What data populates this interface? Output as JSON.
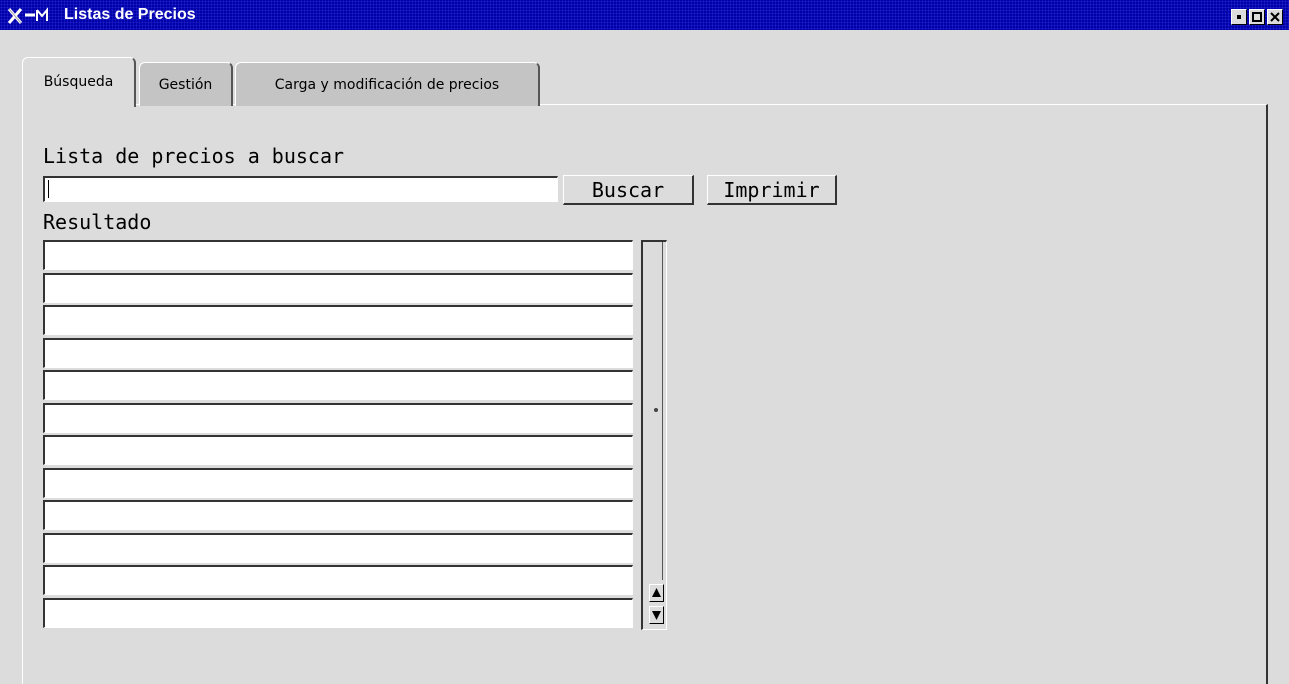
{
  "window": {
    "title": "Listas de Precios",
    "title_icon": "x-window-icon",
    "controls": [
      "minimize-icon",
      "maximize-icon",
      "close-icon"
    ]
  },
  "tabs": [
    {
      "label": "Búsqueda",
      "active": true
    },
    {
      "label": "Gestión",
      "active": false
    },
    {
      "label": "Carga y modificación de precios",
      "active": false
    }
  ],
  "search": {
    "label": "Lista de precios a buscar",
    "value": "",
    "search_button": "Buscar",
    "print_button": "Imprimir"
  },
  "results": {
    "label": "Resultado",
    "rows": [
      "",
      "",
      "",
      "",
      "",
      "",
      "",
      "",
      "",
      "",
      "",
      ""
    ]
  },
  "colors": {
    "titlebar": "#0000aa",
    "background": "#dcdcdc",
    "field": "#ffffff"
  }
}
